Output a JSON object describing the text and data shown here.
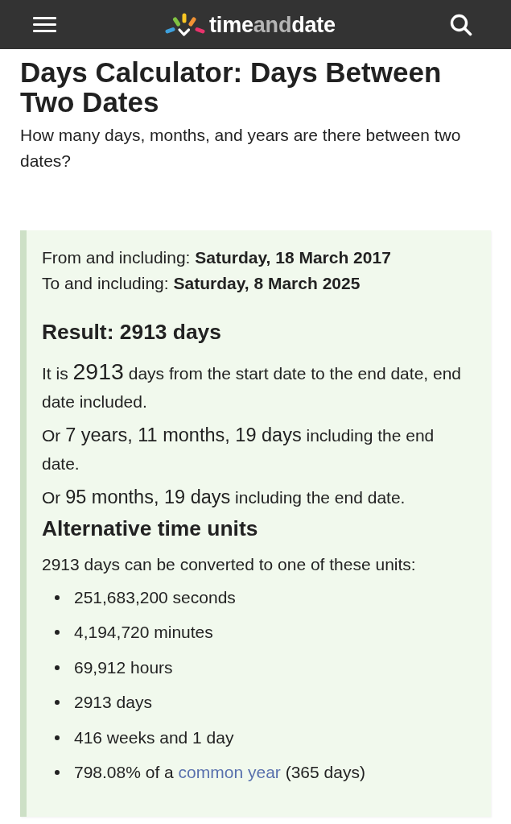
{
  "header": {
    "logo": [
      {
        "text": "time",
        "muted": false
      },
      {
        "text": "and",
        "muted": true
      },
      {
        "text": "date",
        "muted": false
      }
    ]
  },
  "page": {
    "title": "Days Calculator: Days Between Two Dates",
    "subtitle": "How many days, months, and years are there between two dates?"
  },
  "result": {
    "from": "From and including: **Saturday, 18 March 2017**",
    "to": "To and including: **Saturday, 8 March 2025**",
    "heading": "Result: 2913 days",
    "sentences": [
      {
        "parts": [
          {
            "text": "It is ",
            "kind": "plain"
          },
          {
            "text": "2913",
            "kind": "count"
          },
          {
            "text": " days from the start date to the end date, end date included.",
            "kind": "plain"
          }
        ]
      },
      {
        "parts": [
          {
            "text": "Or ",
            "kind": "plain"
          },
          {
            "text": "7 years, 11 months, 19 days",
            "kind": "duration"
          },
          {
            "text": " including the end date.",
            "kind": "plain"
          }
        ]
      },
      {
        "parts": [
          {
            "text": "Or ",
            "kind": "plain"
          },
          {
            "text": "95 months, 19 days",
            "kind": "duration"
          },
          {
            "text": " including the end date.",
            "kind": "plain"
          }
        ]
      }
    ]
  },
  "alternative": {
    "heading": "Alternative time units",
    "intro": "2913 days can be converted to one of these units:",
    "units": [
      {
        "text": "251,683,200 seconds"
      },
      {
        "text": "4,194,720 minutes"
      },
      {
        "text": "69,912 hours"
      },
      {
        "text": "2913 days"
      },
      {
        "text": "416 weeks and 1 day"
      },
      {
        "text": "798.08% of a ",
        "link": "common year",
        "after": " (365 days)"
      }
    ]
  }
}
